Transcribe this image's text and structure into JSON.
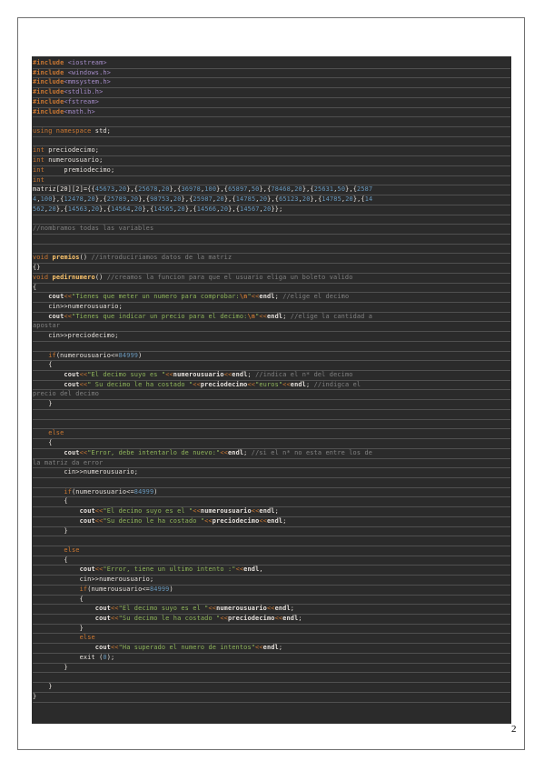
{
  "page_number": "2",
  "lines": [
    [
      "inc:#include",
      "t: ",
      "hdr:<iostream>"
    ],
    [
      "inc:#include",
      "t: ",
      "hdr:<windows.h>"
    ],
    [
      "inc:#include",
      "hdr:<mmsystem.h>"
    ],
    [
      "inc:#include",
      "hdr:<stdlib.h>"
    ],
    [
      "inc:#include",
      "hdr:<fstream>"
    ],
    [
      "inc:#include",
      "hdr:<math.h>"
    ],
    [],
    [
      "kw:using namespace",
      "t: std;"
    ],
    [],
    [
      "kw:int",
      "t: preciodecimo;"
    ],
    [
      "kw:int",
      "t: numerousuario;"
    ],
    [
      "kw:int",
      "t:     premiodecimo;"
    ],
    [
      "kw:int"
    ],
    [
      "t:matriz[20][2]={{",
      "num:45673",
      "t:,",
      "num:20",
      "t:},{",
      "num:25678",
      "t:,",
      "num:20",
      "t:},{",
      "num:36978",
      "t:,",
      "num:100",
      "t:},{",
      "num:65897",
      "t:,",
      "num:50",
      "t:},{",
      "num:78468",
      "t:,",
      "num:20",
      "t:},{",
      "num:25631",
      "t:,",
      "num:50",
      "t:},{",
      "num:2587"
    ],
    [
      "num:4",
      "t:,",
      "num:100",
      "t:},{",
      "num:12478",
      "t:,",
      "num:20",
      "t:},{",
      "num:25789",
      "t:,",
      "num:20",
      "t:},{",
      "num:98753",
      "t:,",
      "num:20",
      "t:},{",
      "num:25987",
      "t:,",
      "num:20",
      "t:},{",
      "num:14785",
      "t:,",
      "num:20",
      "t:},{",
      "num:65123",
      "t:,",
      "num:20",
      "t:},{",
      "num:14785",
      "t:,",
      "num:20",
      "t:},{",
      "num:14"
    ],
    [
      "num:562",
      "t:,",
      "num:20",
      "t:},{",
      "num:14563",
      "t:,",
      "num:20",
      "t:},{",
      "num:14564",
      "t:,",
      "num:20",
      "t:},{",
      "num:14565",
      "t:,",
      "num:20",
      "t:},{",
      "num:14566",
      "t:,",
      "num:20",
      "t:},{",
      "num:14567",
      "t:,",
      "num:20",
      "t:}};"
    ],
    [],
    [
      "cmt://nombramos todas las variables"
    ],
    [],
    [],
    [
      "kw:void",
      "t: ",
      "fn:premios",
      "t:() ",
      "cmt://introduciriamos datos de la matriz"
    ],
    [
      "t:{}"
    ],
    [
      "kw:void",
      "t: ",
      "fn:pedirnumero",
      "t:() ",
      "cmt://creamos la funcion para que el usuario eliga un boleto valido"
    ],
    [
      "t:{"
    ],
    [
      "t:    ",
      "bold:cout",
      "op:<<",
      "str:\"Tienes que meter un numero para comprobar:",
      "esc:\\n",
      "str:\"",
      "op:<<",
      "bold:endl",
      "t:; ",
      "cmt://elige el decimo"
    ],
    [
      "t:    cin>>numerousuario;"
    ],
    [
      "t:    ",
      "bold:cout",
      "op:<<",
      "str:\"Tienes que indicar un precio para el decimo:",
      "esc:\\n",
      "str:\"",
      "op:<<",
      "bold:endl",
      "t:; ",
      "cmt://elige la cantidad a"
    ],
    [
      "cmt:apostar"
    ],
    [
      "t:    cin>>preciodecimo;"
    ],
    [],
    [
      "t:    ",
      "kw:if",
      "t:(numerousuario<=",
      "num:84999",
      "t:)"
    ],
    [
      "t:    {"
    ],
    [
      "t:        ",
      "bold:cout",
      "op:<<",
      "str:\"El decimo suyo es \"",
      "op:<<",
      "bold:numerousuario",
      "op:<<",
      "bold:endl",
      "t:; ",
      "cmt://indica el n* del decimo"
    ],
    [
      "t:        ",
      "bold:cout",
      "op:<<",
      "str:\" Su decimo le ha costado \"",
      "op:<<",
      "bold:preciodecimo",
      "op:<<",
      "str:\"euros\"",
      "op:<<",
      "bold:endl",
      "t:; ",
      "cmt://indigca el"
    ],
    [
      "cmt:precio del decimo"
    ],
    [
      "t:    }"
    ],
    [],
    [],
    [
      "t:    ",
      "kw:else"
    ],
    [
      "t:    {"
    ],
    [
      "t:        ",
      "bold:cout",
      "op:<<",
      "str:\"Error, debe intentarlo de nuevo:\"",
      "op:<<",
      "bold:endl",
      "t:; ",
      "cmt://si el n* no esta entre los de"
    ],
    [
      "cmt:la matriz da error"
    ],
    [
      "t:        cin>>numerousuario;"
    ],
    [],
    [
      "t:        ",
      "kw:if",
      "t:(numerousuario<=",
      "num:84999",
      "t:)"
    ],
    [
      "t:        {"
    ],
    [
      "t:            ",
      "bold:cout",
      "op:<<",
      "str:\"El decimo suyo es el \"",
      "op:<<",
      "bold:numerousuario",
      "op:<<",
      "bold:endl",
      "t:;"
    ],
    [
      "t:            ",
      "bold:cout",
      "op:<<",
      "str:\"Su decimo le ha costado \"",
      "op:<<",
      "bold:preciodecimo",
      "op:<<",
      "bold:endl",
      "t:;"
    ],
    [
      "t:        }"
    ],
    [],
    [
      "t:        ",
      "kw:else"
    ],
    [
      "t:        {"
    ],
    [
      "t:            ",
      "bold:cout",
      "op:<<",
      "str:\"Error, tiene un ultimo intento :\"",
      "op:<<",
      "bold:endl",
      "t:,"
    ],
    [
      "t:            cin>>numerousuario;"
    ],
    [
      "t:            ",
      "kw:if",
      "t:(numerousuario<=",
      "num:84999",
      "t:)"
    ],
    [
      "t:            {"
    ],
    [
      "t:                ",
      "bold:cout",
      "op:<<",
      "str:\"El decimo suyo es el \"",
      "op:<<",
      "bold:numerousuario",
      "op:<<",
      "bold:endl",
      "t:;"
    ],
    [
      "t:                ",
      "bold:cout",
      "op:<<",
      "str:\"Su decimo le ha costado \"",
      "op:<<",
      "bold:preciodecimo",
      "op:<<",
      "bold:endl",
      "t:;"
    ],
    [
      "t:            }"
    ],
    [
      "t:            ",
      "kw:else"
    ],
    [
      "t:                ",
      "bold:cout",
      "op:<<",
      "str:\"Ha superado el numero de intentos\"",
      "op:<<",
      "bold:endl",
      "t:;"
    ],
    [
      "t:            exit (",
      "num:0",
      "t:);"
    ],
    [
      "t:        }"
    ],
    [],
    [
      "t:    }"
    ],
    [
      "t:}"
    ]
  ]
}
